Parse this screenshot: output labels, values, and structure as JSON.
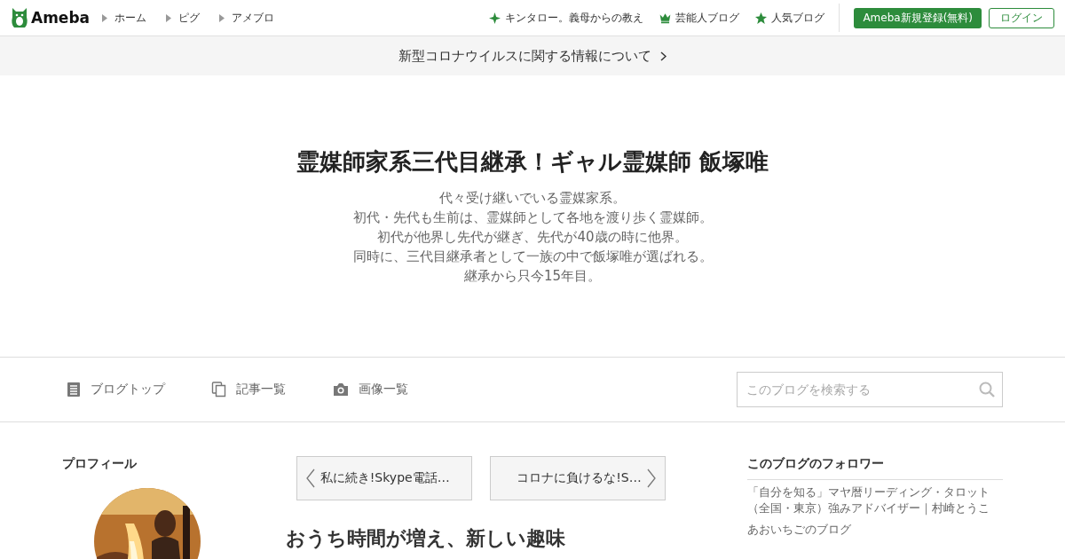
{
  "header": {
    "logo": "Ameba",
    "nav": [
      {
        "label": "ホーム"
      },
      {
        "label": "ピグ"
      },
      {
        "label": "アメブロ"
      }
    ],
    "links": [
      {
        "kind": "sparkle",
        "label": "キンタロー。義母からの教え"
      },
      {
        "kind": "crown",
        "label": "芸能人ブログ"
      },
      {
        "kind": "star",
        "label": "人気ブログ"
      }
    ],
    "signup": "Ameba新規登録(無料)",
    "login": "ログイン"
  },
  "notice": "新型コロナウイルスに関する情報について",
  "blog": {
    "title": "霊媒師家系三代目継承！ギャル霊媒師 飯塚唯",
    "description": [
      "代々受け継いでいる霊媒家系。",
      "初代・先代も生前は、霊媒師として各地を渡り歩く霊媒師。",
      "初代が他界し先代が継ぎ、先代が40歳の時に他界。",
      "同時に、三代目継承者として一族の中で飯塚唯が選ばれる。",
      "継承から只今15年目。"
    ]
  },
  "blog_nav": [
    {
      "kind": "top",
      "label": "ブログトップ"
    },
    {
      "kind": "list",
      "label": "記事一覧"
    },
    {
      "kind": "images",
      "label": "画像一覧"
    }
  ],
  "search": {
    "placeholder": "このブログを検索する"
  },
  "profile": {
    "heading": "プロフィール"
  },
  "article_nav": {
    "previous": "私に続き!Skype電話…",
    "next": "コロナに負けるな!S…"
  },
  "article": {
    "title": "おうち時間が増え、新しい趣味"
  },
  "followers": {
    "heading": "このブログのフォロワー",
    "items": [
      "「自分を知る」マヤ暦リーディング・タロット（全国・東京）強みアドバイザー｜村崎とうこ",
      "あおいちごのブログ"
    ]
  }
}
